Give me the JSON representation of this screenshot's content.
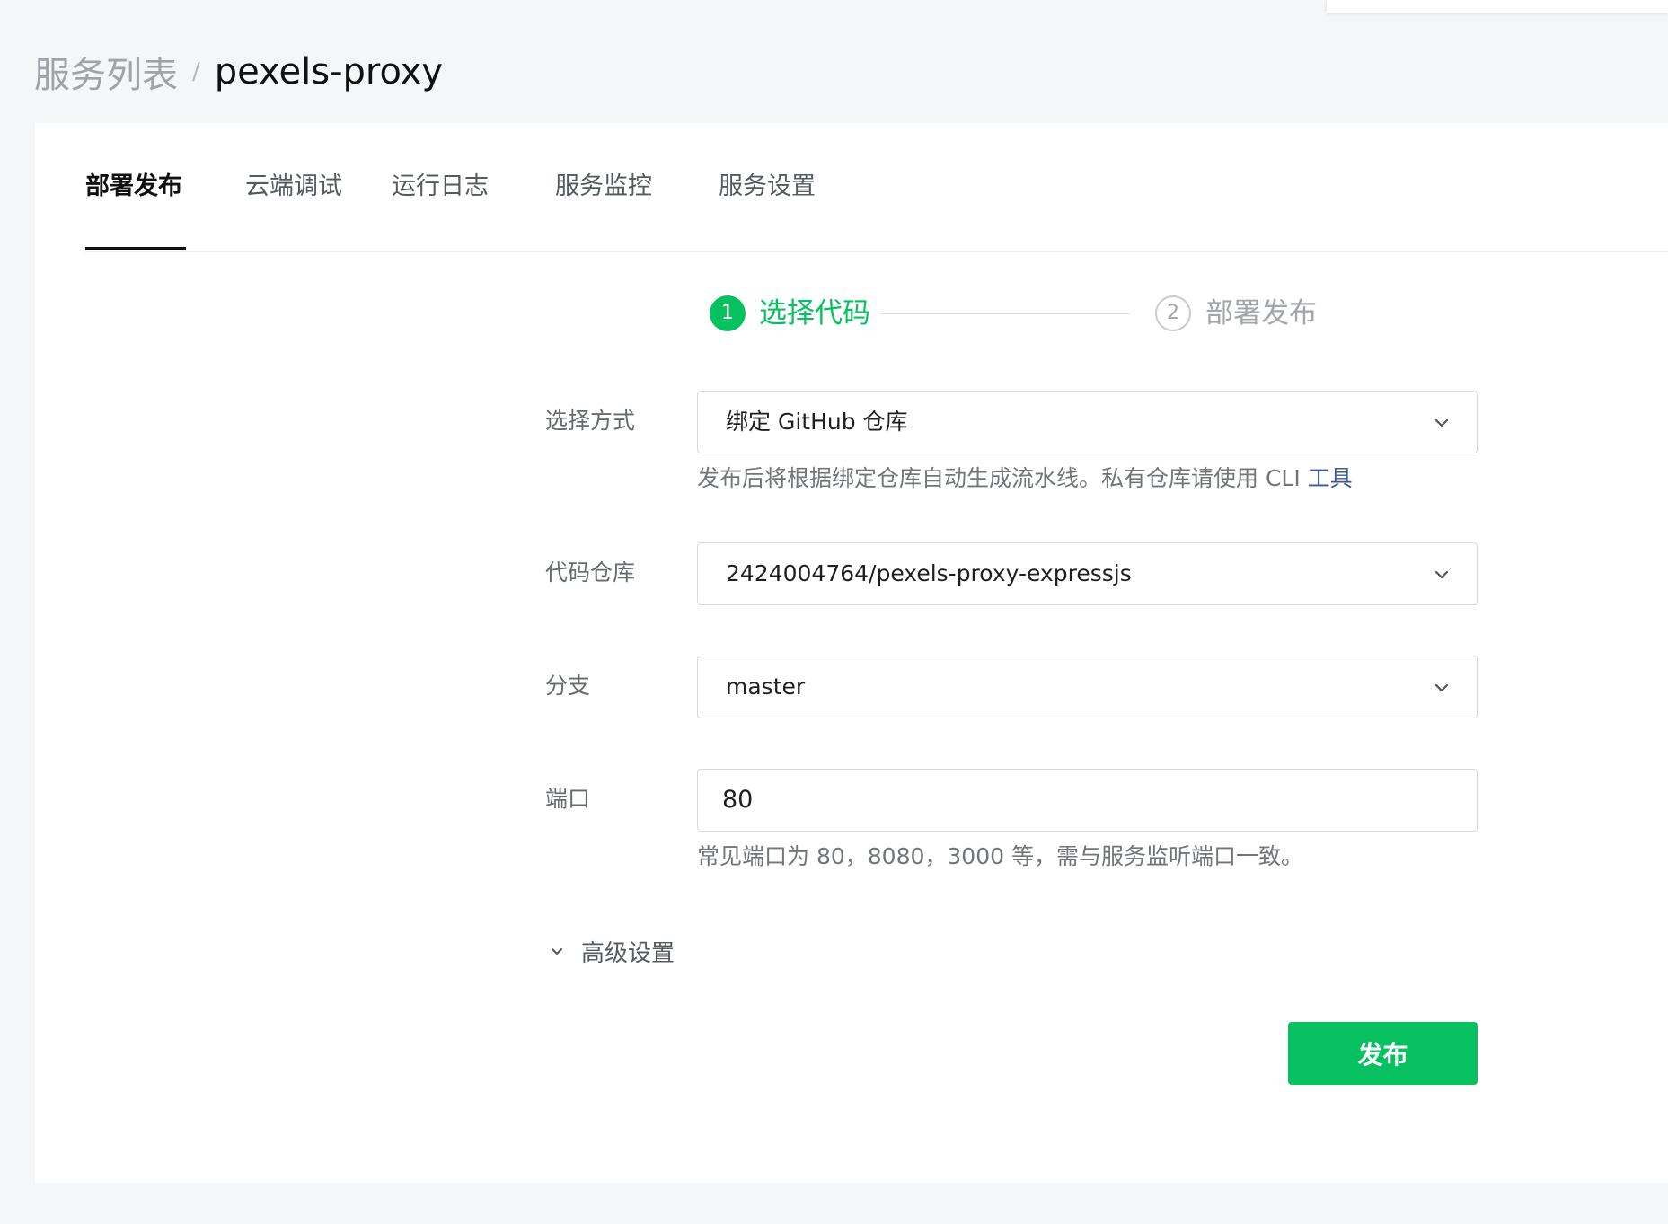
{
  "breadcrumb": {
    "parent": "服务列表",
    "separator": "/",
    "current": "pexels-proxy"
  },
  "tabs": [
    {
      "label": "部署发布",
      "active": true
    },
    {
      "label": "云端调试",
      "active": false
    },
    {
      "label": "运行日志",
      "active": false
    },
    {
      "label": "服务监控",
      "active": false
    },
    {
      "label": "服务设置",
      "active": false
    }
  ],
  "steps": [
    {
      "number": "1",
      "label": "选择代码",
      "status": "active"
    },
    {
      "number": "2",
      "label": "部署发布",
      "status": "inactive"
    }
  ],
  "form": {
    "method": {
      "label": "选择方式",
      "value": "绑定 GitHub 仓库",
      "helper": "发布后将根据绑定仓库自动生成流水线。私有仓库请使用 CLI ",
      "helper_link": "工具"
    },
    "repo": {
      "label": "代码仓库",
      "value": "2424004764/pexels-proxy-expressjs"
    },
    "branch": {
      "label": "分支",
      "value": "master"
    },
    "port": {
      "label": "端口",
      "value": "80",
      "helper": "常见端口为 80，8080，3000 等，需与服务监听端口一致。"
    },
    "advanced_label": "高级设置"
  },
  "submit_label": "发布",
  "colors": {
    "accent": "#07c160",
    "link": "#3f5b8e",
    "page_bg": "#f5f6f7",
    "card_bg": "#ffffff"
  },
  "icons": [
    "chevron-down-icon",
    "expand-chevron-icon"
  ]
}
